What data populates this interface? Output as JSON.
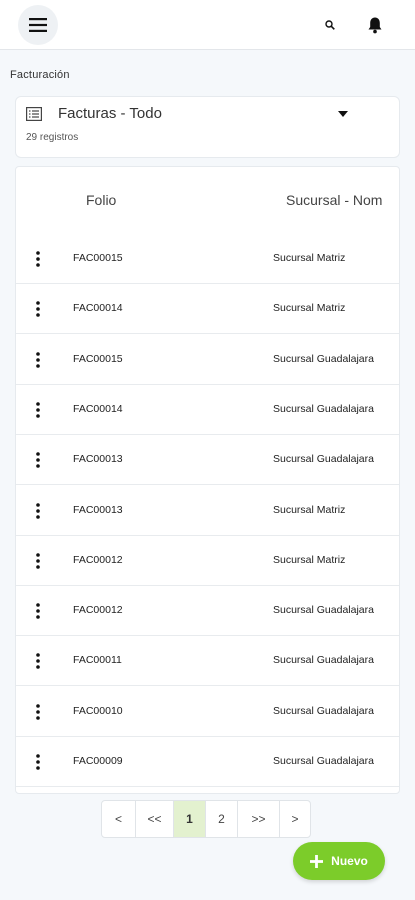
{
  "header": {
    "menu_icon": "hamburger-icon",
    "search_icon": "search-icon",
    "bell_icon": "bell-icon"
  },
  "section_title": "Facturación",
  "selector": {
    "icon": "list-icon",
    "title": "Facturas - Todo",
    "count": "29 registros"
  },
  "table": {
    "headers": [
      "Folio",
      "Sucursal - Nom"
    ],
    "rows": [
      {
        "folio": "FAC00015",
        "sucursal": "Sucursal Matriz"
      },
      {
        "folio": "FAC00014",
        "sucursal": "Sucursal Matriz"
      },
      {
        "folio": "FAC00015",
        "sucursal": "Sucursal Guadalajara"
      },
      {
        "folio": "FAC00014",
        "sucursal": "Sucursal Guadalajara"
      },
      {
        "folio": "FAC00013",
        "sucursal": "Sucursal Guadalajara"
      },
      {
        "folio": "FAC00013",
        "sucursal": "Sucursal Matriz"
      },
      {
        "folio": "FAC00012",
        "sucursal": "Sucursal Matriz"
      },
      {
        "folio": "FAC00012",
        "sucursal": "Sucursal Guadalajara"
      },
      {
        "folio": "FAC00011",
        "sucursal": "Sucursal Guadalajara"
      },
      {
        "folio": "FAC00010",
        "sucursal": "Sucursal Guadalajara"
      },
      {
        "folio": "FAC00009",
        "sucursal": "Sucursal Guadalajara"
      }
    ]
  },
  "pagination": {
    "buttons": [
      {
        "label": "<",
        "active": false
      },
      {
        "label": "<<",
        "active": false
      },
      {
        "label": "1",
        "active": true
      },
      {
        "label": "2",
        "active": false
      },
      {
        "label": ">>",
        "active": false
      },
      {
        "label": ">",
        "active": false
      }
    ]
  },
  "fab": {
    "label": "Nuevo",
    "color": "#7ccc2a"
  }
}
